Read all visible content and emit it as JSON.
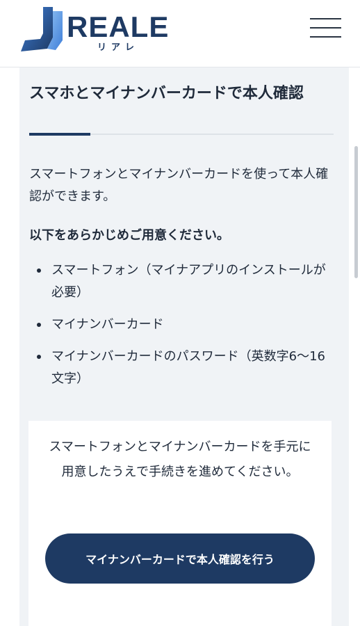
{
  "header": {
    "logo_text": "REALE",
    "logo_sub": "リアレ",
    "menu_icon": "hamburger-icon"
  },
  "colors": {
    "brand": "#1e3a63",
    "panel_bg": "#f0f3f6",
    "text": "#1f2a3a"
  },
  "main": {
    "title": "スマホとマイナンバーカードで本人確認",
    "intro": "スマートフォンとマイナンバーカードを使って本人確認ができます。",
    "prepare_heading": "以下をあらかじめご用意ください。",
    "requirements": [
      "スマートフォン（マイナアプリのインストールが必要）",
      "マイナンバーカード",
      "マイナンバーカードのパスワード（英数字6〜16文字）"
    ],
    "card": {
      "note": "スマートフォンとマイナンバーカードを手元に用意したうえで手続きを進めてください。",
      "button_label": "マイナンバーカードで本人確認を行う"
    }
  }
}
